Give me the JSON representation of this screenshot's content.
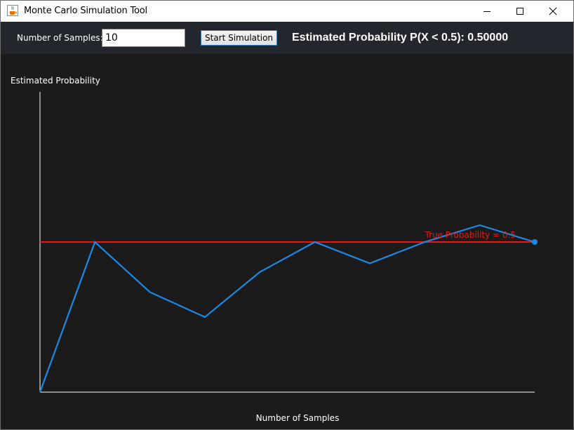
{
  "window": {
    "title": "Monte Carlo Simulation Tool",
    "icon": "java-cup-icon"
  },
  "toolbar": {
    "samples_label": "Number of Samples:",
    "samples_value": "10",
    "start_label": "Start Simulation",
    "estimate_text": "Estimated Probability P(X < 0.5): 0.50000"
  },
  "colors": {
    "background": "#1b1b1c",
    "toolbar": "#23272d",
    "line": "#1e88e5",
    "true_line": "#e01b1b",
    "axis": "#ffffff"
  },
  "chart_data": {
    "type": "line",
    "title": "",
    "xlabel": "Number of Samples",
    "ylabel": "Estimated Probability",
    "x": [
      0,
      1,
      2,
      3,
      4,
      5,
      6,
      7,
      8,
      9
    ],
    "series": [
      {
        "values": [
          0.0,
          0.5,
          0.333,
          0.25,
          0.4,
          0.5,
          0.429,
          0.5,
          0.556,
          0.5
        ]
      }
    ],
    "reference_line": {
      "label": "True Probability = 0.5",
      "value": 0.5
    },
    "xlim": [
      0,
      9
    ],
    "ylim": [
      0,
      1
    ],
    "grid": false
  }
}
